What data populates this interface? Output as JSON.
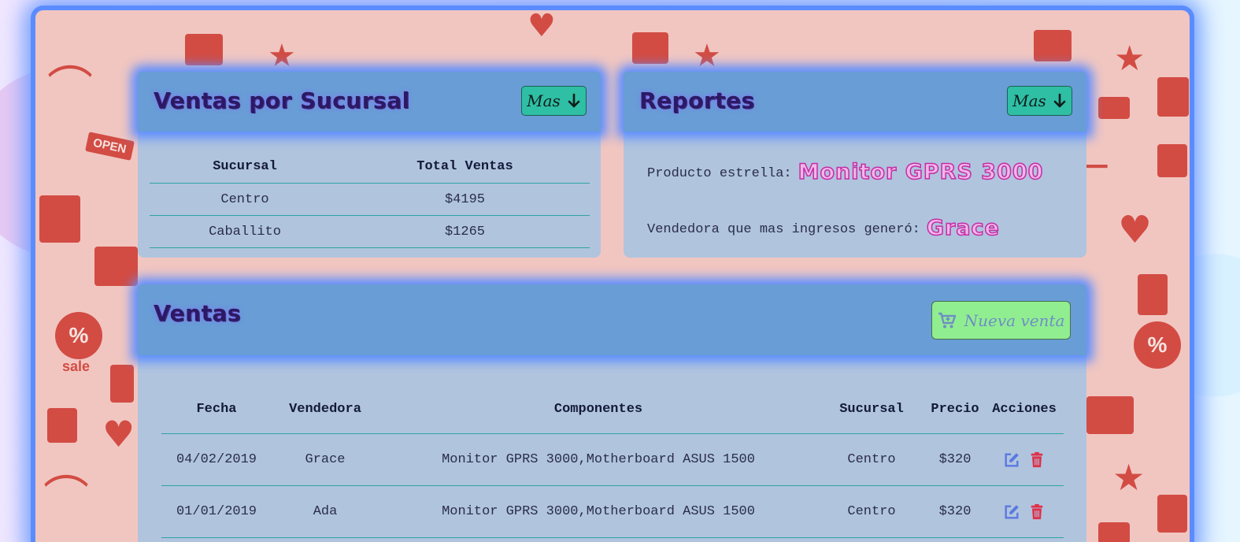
{
  "ventas_por_sucursal": {
    "title": "Ventas por Sucursal",
    "more_button": "Mas",
    "columns": [
      "Sucursal",
      "Total Ventas"
    ],
    "rows": [
      [
        "Centro",
        "$4195"
      ],
      [
        "Caballito",
        "$1265"
      ]
    ]
  },
  "reportes": {
    "title": "Reportes",
    "more_button": "Mas",
    "producto_label": "Producto estrella:",
    "producto_value": "Monitor GPRS 3000",
    "vendedora_label": "Vendedora que mas ingresos generó:",
    "vendedora_value": "Grace"
  },
  "ventas": {
    "title": "Ventas",
    "new_button": "Nueva venta",
    "columns": [
      "Fecha",
      "Vendedora",
      "Componentes",
      "Sucursal",
      "Precio",
      "Acciones"
    ],
    "rows": [
      [
        "04/02/2019",
        "Grace",
        "Monitor GPRS 3000,Motherboard ASUS 1500",
        "Centro",
        "$320"
      ],
      [
        "01/01/2019",
        "Ada",
        "Monitor GPRS 3000,Motherboard ASUS 1500",
        "Centro",
        "$320"
      ]
    ]
  },
  "icons": {
    "more": "arrow-down-icon",
    "new_sale": "cart-icon",
    "edit": "edit-icon",
    "delete": "trash-icon"
  },
  "colors": {
    "background_pattern": "#f1c6c1",
    "pattern_icons": "#d24c44",
    "card_body": "#b0c4de",
    "card_header": "#689dd6",
    "glow": "#5b8cff",
    "mas_button": "#2ebfa5",
    "nueva_button": "#90ee90",
    "edit_icon": "#5a78e0",
    "delete_icon": "#e0304a"
  }
}
